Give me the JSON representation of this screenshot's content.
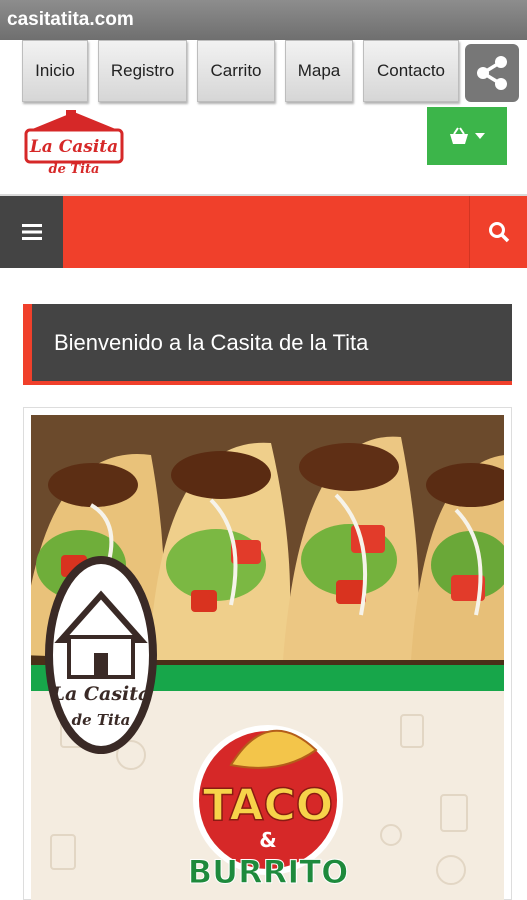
{
  "browser": {
    "title": "casitatita.com"
  },
  "nav": {
    "items": [
      {
        "label": "Inicio"
      },
      {
        "label": "Registro"
      },
      {
        "label": "Carrito"
      },
      {
        "label": "Mapa"
      },
      {
        "label": "Contacto"
      }
    ]
  },
  "logo": {
    "line1": "La Casita",
    "line2": "de Tita"
  },
  "welcome": {
    "title": "Bienvenido a la Casita de la Tita"
  },
  "banner": {
    "badge_line1": "La Casita",
    "badge_line2": "de Tita",
    "taco_word": "TACO",
    "amp": "&",
    "burrito_word": "BURRITO"
  },
  "colors": {
    "accent": "#f0402b",
    "dark": "#444444",
    "green": "#3cb54a"
  }
}
